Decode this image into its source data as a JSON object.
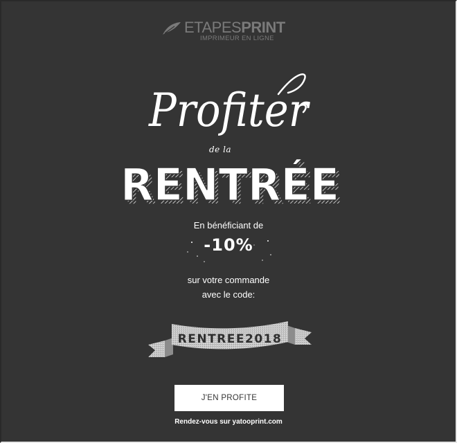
{
  "brand": {
    "name_light": "ETAPES",
    "name_bold": "PRINT",
    "tagline": "IMPRIMEUR EN LIGNE",
    "color": "#7a7a7a"
  },
  "headline": {
    "script": "Profiter",
    "connector": "de la",
    "big": "RENTRÉE"
  },
  "offer": {
    "intro": "En bénéficiant de",
    "discount": "-10%",
    "order_text": "sur votre commande",
    "code_label": "avec le code:",
    "code": "RENTREE2018"
  },
  "cta": {
    "label": "J'EN PROFITE"
  },
  "footer": {
    "link_text": "Rendez-vous sur yatooprint.com"
  },
  "colors": {
    "background": "#343434",
    "text": "#ffffff",
    "button_bg": "#ffffff",
    "button_text": "#333333",
    "banner": "#c8c8c8"
  }
}
